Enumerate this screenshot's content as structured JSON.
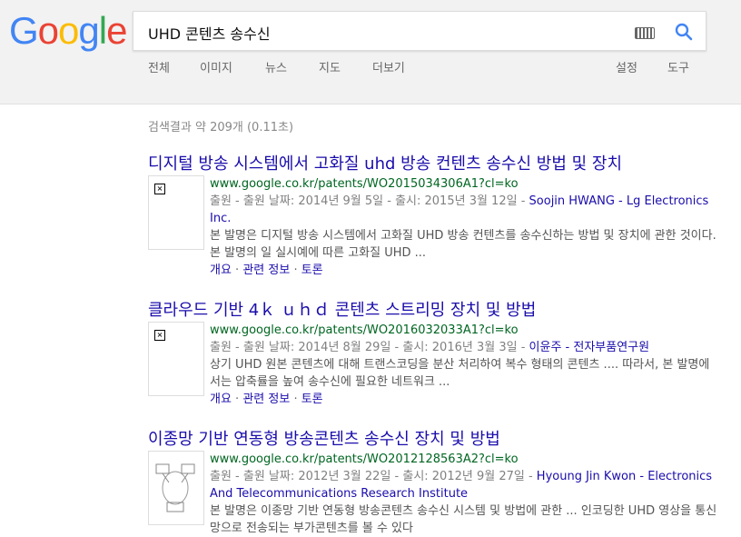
{
  "logo": {
    "letters": [
      "G",
      "o",
      "o",
      "g",
      "l",
      "e"
    ],
    "colors": [
      "#4285F4",
      "#EA4335",
      "#FBBC05",
      "#4285F4",
      "#34A853",
      "#EA4335"
    ]
  },
  "search": {
    "query": "UHD 콘텐츠 송수신"
  },
  "nav": {
    "left": [
      "전체",
      "이미지",
      "뉴스",
      "지도",
      "더보기"
    ],
    "right": [
      "설정",
      "도구"
    ]
  },
  "stats": "검색결과 약 209개 (0.11초)",
  "results": [
    {
      "title": "디지털 방송 시스템에서 고화질 uhd 방송 컨텐츠 송수신 방법 및 장치",
      "url": "www.google.co.kr/patents/WO2015034306A1?cl=ko",
      "meta_prefix": "출원 - 출원 날짜: 2014년 9월 5일 - 출시: 2015년 3월 12일 - ",
      "meta_name": "Soojin HWANG - Lg Electronics Inc.",
      "snippet": "본 발명은 디지털 방송 시스템에서 고화질 UHD 방송 컨텐츠를 송수신하는 방법 및 장치에 관한 것이다. 본 발명의 일 실시예에 따른 고화질 UHD ...",
      "links": [
        "개요",
        "관련 정보",
        "토론"
      ]
    },
    {
      "title": "클라우드 기반 4ｋ ｕｈｄ 콘텐츠 스트리밍 장치 및 방법",
      "url": "www.google.co.kr/patents/WO2016032033A1?cl=ko",
      "meta_prefix": "출원 - 출원 날짜: 2014년 8월 29일 - 출시: 2016년 3월 3일 - ",
      "meta_name": "이윤주 - 전자부품연구원",
      "snippet": "상기 UHD 원본 콘텐츠에 대해 트랜스코딩을 분산 처리하여 복수 형태의 콘텐츠 .... 따라서, 본 발명에서는 압축률을 높여 송수신에 필요한 네트워크 ...",
      "links": [
        "개요",
        "관련 정보",
        "토론"
      ]
    },
    {
      "title": "이종망 기반 연동형 방송콘텐츠 송수신 장치 및 방법",
      "url": "www.google.co.kr/patents/WO2012128563A2?cl=ko",
      "meta_prefix": "출원 - 출원 날짜: 2012년 3월 22일 - 출시: 2012년 9월 27일 - ",
      "meta_name": "Hyoung Jin Kwon - Electronics And Telecommunications Research Institute",
      "snippet": "본 발명은 이종망 기반 연동형 방송콘텐츠 송수신 시스템 및 방법에 관한 ... 인코딩한 UHD 영상을 통신망으로 전송되는 부가콘텐츠를 볼 수 있다",
      "links": []
    }
  ]
}
